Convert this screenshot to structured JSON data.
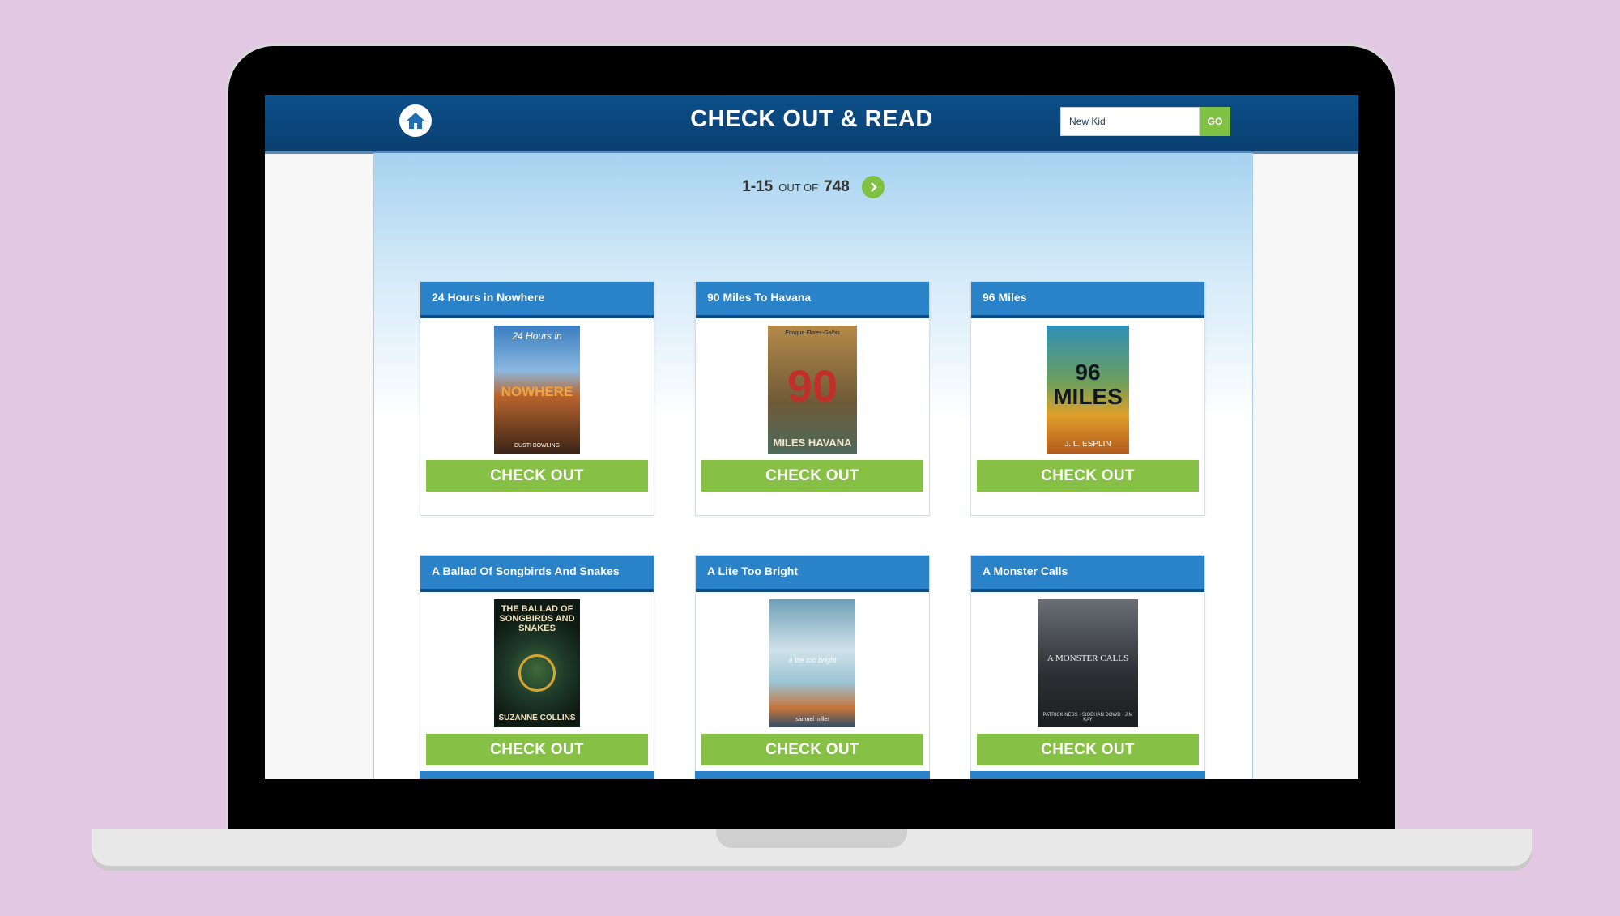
{
  "header": {
    "title": "CHECK OUT & READ",
    "search": {
      "value": "New Kid",
      "button_label": "GO"
    }
  },
  "pager": {
    "range": "1-15",
    "out_of": "OUT OF",
    "total": "748"
  },
  "books": [
    {
      "title": "24 Hours in Nowhere",
      "button_label": "CHECK OUT",
      "cover": {
        "top": "24 Hours in",
        "main": "NOWHERE",
        "bottom": "DUSTI BOWLING",
        "bg": "#5b3a2a",
        "fg": "#f0a23a"
      }
    },
    {
      "title": "90 Miles To Havana",
      "button_label": "CHECK OUT",
      "cover": {
        "top": "Enrique Flores-Galbis",
        "main": "90",
        "bottom": "MILES HAVANA",
        "bg": "#7b6a47",
        "fg": "#c0302a"
      }
    },
    {
      "title": "96 Miles",
      "button_label": "CHECK OUT",
      "cover": {
        "top": "",
        "main": "96 MILES",
        "bottom": "J. L. ESPLIN",
        "bg": "#3e4a3a",
        "fg": "#101820"
      }
    },
    {
      "title": "A Ballad Of Songbirds And Snakes",
      "button_label": "CHECK OUT",
      "cover": {
        "top": "THE BALLAD OF SONGBIRDS AND SNAKES",
        "main": "",
        "bottom": "SUZANNE COLLINS",
        "bg": "#15241c",
        "fg": "#e8d9b0"
      }
    },
    {
      "title": "A Lite Too Bright",
      "button_label": "CHECK OUT",
      "cover": {
        "top": "",
        "main": "a lite too bright",
        "bottom": "samuel miller",
        "bg": "#6e9fb6",
        "fg": "#f2f6f8"
      }
    },
    {
      "title": "A Monster Calls",
      "button_label": "CHECK OUT",
      "cover": {
        "top": "",
        "main": "A MONSTER CALLS",
        "bottom": "PATRICK NESS · SIOBHAN DOWD · JIM KAY",
        "bg": "#2b2f33",
        "fg": "#e9e9e9"
      }
    }
  ]
}
